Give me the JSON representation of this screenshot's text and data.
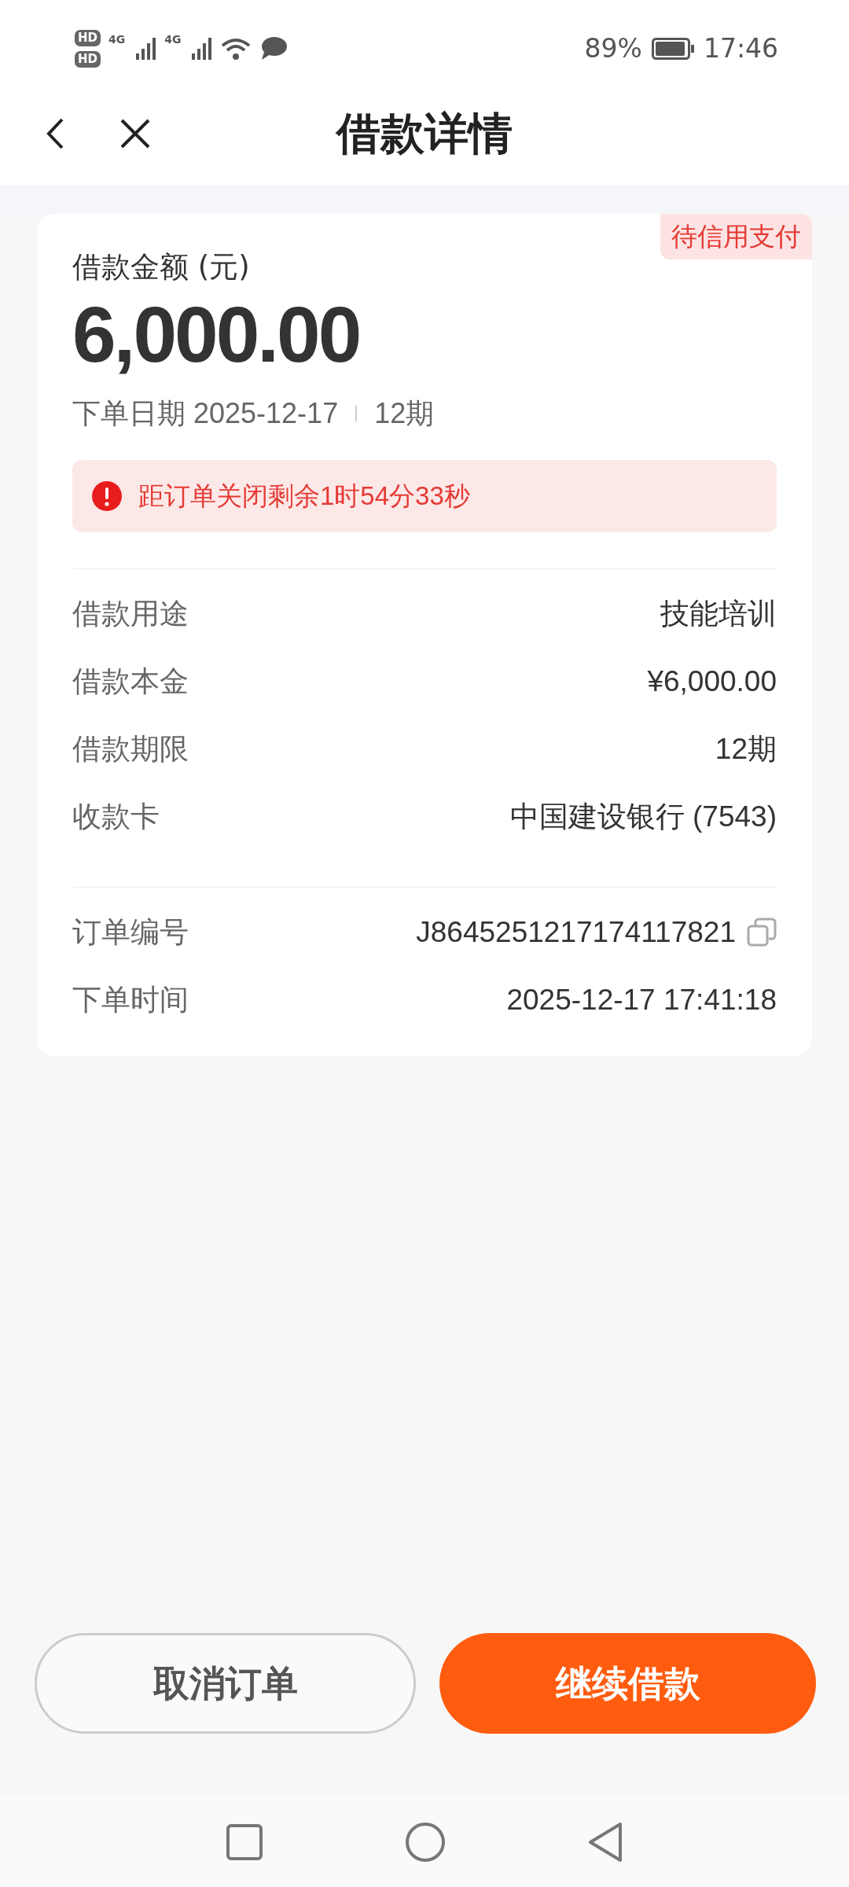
{
  "status_bar": {
    "sim_labels": [
      "HD",
      "HD"
    ],
    "network_labels": [
      "4G",
      "4G"
    ],
    "battery_text": "89%",
    "time": "17:46"
  },
  "header": {
    "title": "借款详情"
  },
  "card": {
    "status_badge": "待信用支付",
    "amount_label": "借款金额 (元)",
    "amount": "6,000.00",
    "order_date": "下单日期 2025-12-17",
    "term": "12期",
    "alert": "距订单关闭剩余1时54分33秒",
    "details": [
      {
        "label": "借款用途",
        "value": "技能培训"
      },
      {
        "label": "借款本金",
        "value": "¥6,000.00"
      },
      {
        "label": "借款期限",
        "value": "12期"
      },
      {
        "label": "收款卡",
        "value": "中国建设银行 (7543)"
      }
    ],
    "order_info": [
      {
        "label": "订单编号",
        "value": "J8645251217174117821",
        "copyable": true
      },
      {
        "label": "下单时间",
        "value": "2025-12-17 17:41:18",
        "copyable": false
      }
    ]
  },
  "buttons": [
    {
      "label": "取消订单",
      "kind": "outline"
    },
    {
      "label": "继续借款",
      "kind": "primary"
    }
  ]
}
